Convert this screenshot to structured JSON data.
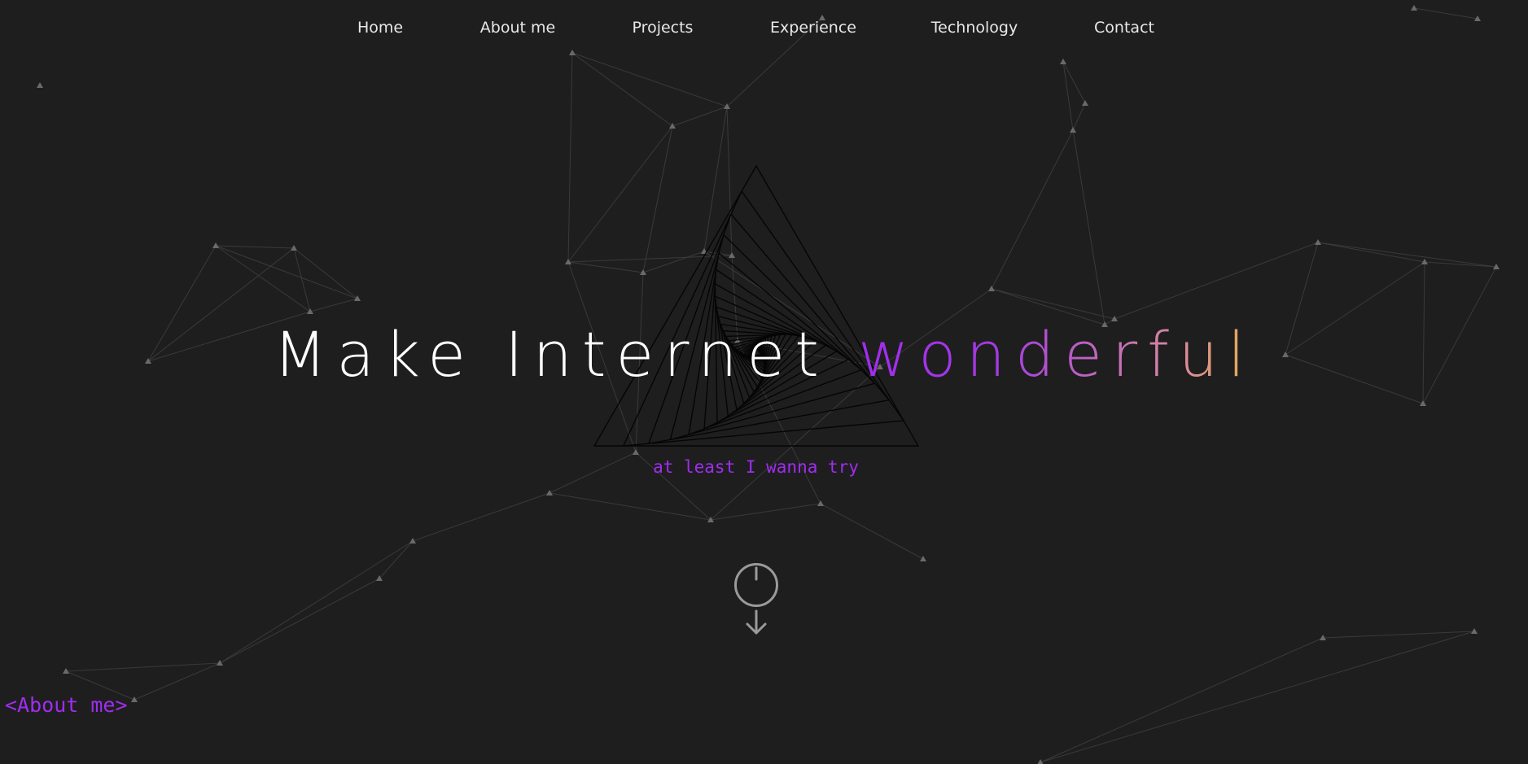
{
  "nav": {
    "items": [
      {
        "label": "Home"
      },
      {
        "label": "About me"
      },
      {
        "label": "Projects"
      },
      {
        "label": "Experience"
      },
      {
        "label": "Technology"
      },
      {
        "label": "Contact"
      }
    ]
  },
  "hero": {
    "title_plain": "Make Internet ",
    "title_accent": "wonderful",
    "tagline": "at least I wanna try"
  },
  "scroll": {
    "icon": "scroll-down-icon"
  },
  "section": {
    "tag": "<About me>"
  },
  "colors": {
    "background": "#1e1e1e",
    "accent_purple": "#a02cf2",
    "accent_gold": "#e7b04f",
    "network_nodes": "#6a6a6a",
    "network_lines": "#3a3a3a"
  }
}
